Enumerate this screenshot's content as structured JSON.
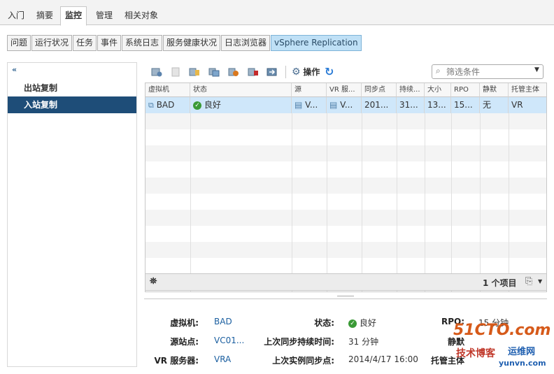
{
  "top_tabs": [
    "入门",
    "摘要",
    "监控",
    "管理",
    "相关对象"
  ],
  "sub_tabs": [
    "问题",
    "运行状况",
    "任务",
    "事件",
    "系统日志",
    "服务健康状况",
    "日志浏览器",
    "vSphere Replication"
  ],
  "left_nav": {
    "collapse_icon": "double-chevron-left-icon",
    "items": [
      "出站复制",
      "入站复制"
    ],
    "selected": "入站复制"
  },
  "toolbar": {
    "actions_label": "操作",
    "filter_placeholder": "筛选条件"
  },
  "grid": {
    "columns": [
      "虚拟机",
      "状态",
      "源",
      "VR 服...",
      "同步点",
      "持续...",
      "大小",
      "RPO",
      "静默",
      "托管主体"
    ],
    "rows": [
      [
        "BAD",
        "良好",
        "V...",
        "V...",
        "201...",
        "31...",
        "13...",
        "15...",
        "无",
        "VR"
      ]
    ],
    "row_count_label": "1 个项目"
  },
  "details": {
    "vm_label": "虚拟机:",
    "vm_value": "BAD",
    "source_site_label": "源站点:",
    "source_site_value": "VC01...",
    "vr_server_label": "VR 服务器:",
    "vr_server_value": "VRA",
    "status_label": "状态:",
    "status_value": "良好",
    "last_sync_duration_label": "上次同步持续时间:",
    "last_sync_duration_value": "31 分钟",
    "last_instance_sync_label": "上次实例同步点:",
    "last_instance_sync_value": "2014/4/17 16:00",
    "rpo_label": "RPO:",
    "rpo_value": "15 分钟",
    "quiesce_label": "静默",
    "managed_by_label": "托管主体"
  },
  "watermark": {
    "site": "51CTO.com",
    "sub1": "技术博客",
    "sub2": "运维网",
    "url": "yunvn.com"
  },
  "colors": {
    "selected_nav": "#1e4d78",
    "selected_row": "#cfe7fa",
    "active_subtab": "#bfe0f6",
    "status_ok": "#3a9a36",
    "link": "#1b5fa0"
  }
}
